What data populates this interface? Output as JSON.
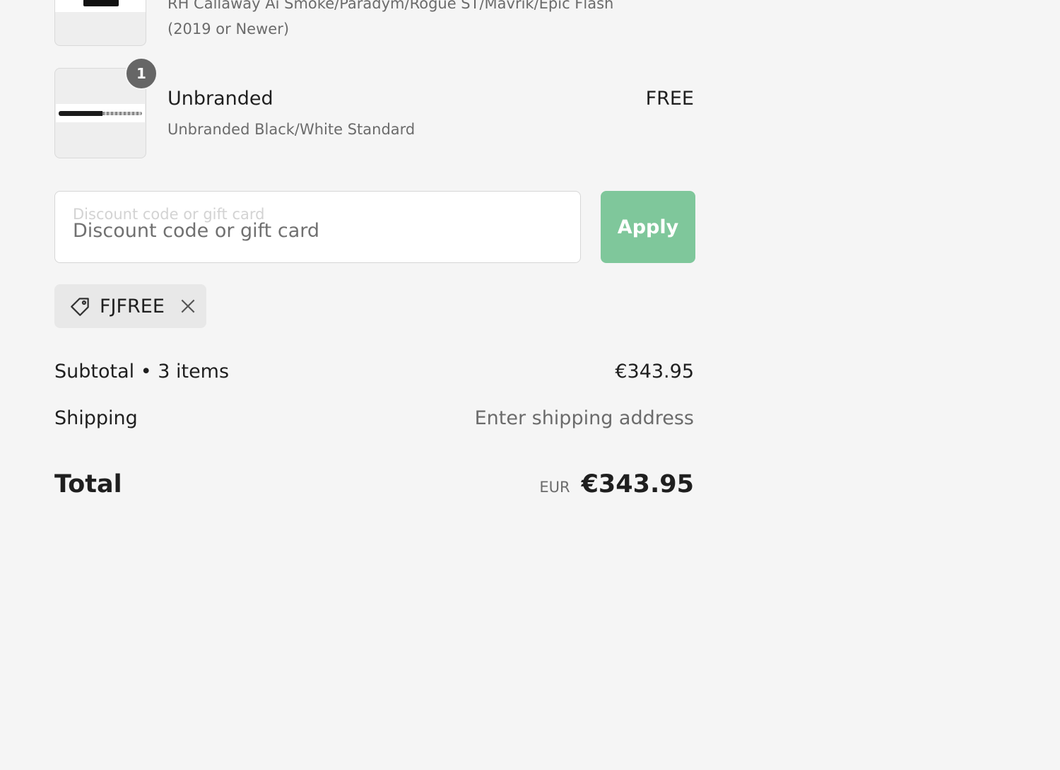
{
  "items": [
    {
      "subtitle_line1": "RH Callaway Ai Smoke/Paradym/Rogue ST/Mavrik/Epic Flash",
      "subtitle_line2": "(2019 or Newer)"
    },
    {
      "quantity": "1",
      "title": "Unbranded",
      "subtitle": "Unbranded Black/White Standard",
      "price": "FREE"
    }
  ],
  "discount": {
    "label": "Discount code or gift card",
    "placeholder": "Discount code or gift card",
    "apply_label": "Apply",
    "applied_code": "FJFREE"
  },
  "summary": {
    "subtotal_label": "Subtotal • 3 items",
    "subtotal_value": "€343.95",
    "shipping_label": "Shipping",
    "shipping_value": "Enter shipping address",
    "total_label": "Total",
    "currency": "EUR",
    "total_value": "€343.95"
  },
  "colors": {
    "apply_button": "#7fc79b",
    "background": "#f5f5f5"
  },
  "icons": {
    "tag": "tag-icon",
    "remove": "close-icon"
  }
}
